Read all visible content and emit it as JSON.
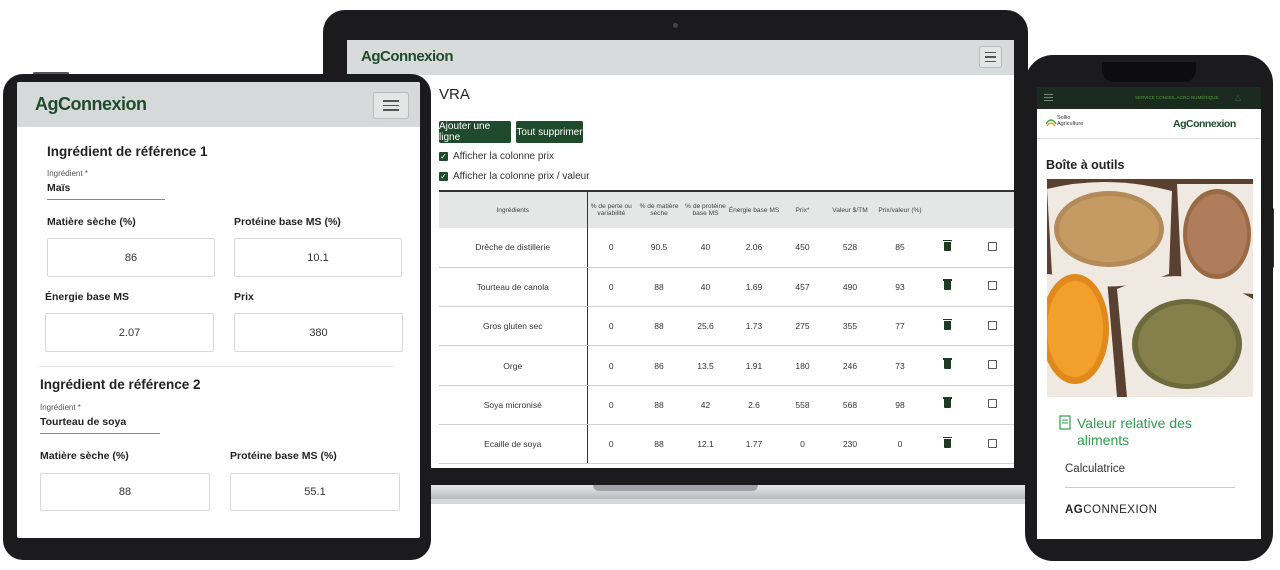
{
  "laptop": {
    "logo": "AgConnexion",
    "page_title": "VRA",
    "buttons": {
      "add_row": "Ajouter une ligne",
      "delete_all": "Tout supprimer"
    },
    "checkboxes": {
      "show_price": "Afficher la colonne prix",
      "show_price_value": "Afficher la colonne prix / valeur"
    },
    "table": {
      "headers": [
        "Ingrédients",
        "% de perte ou variabilité",
        "% de matière sèche",
        "% de protéine base MS",
        "Énergie base MS",
        "Prix*",
        "Valeur $/TM",
        "Prix/valeur (%)"
      ],
      "rows": [
        [
          "Drêche de distillerie",
          "0",
          "90.5",
          "40",
          "2.06",
          "450",
          "528",
          "85"
        ],
        [
          "Tourteau de canola",
          "0",
          "88",
          "40",
          "1.69",
          "457",
          "490",
          "93"
        ],
        [
          "Gros gluten sec",
          "0",
          "88",
          "25.6",
          "1.73",
          "275",
          "355",
          "77"
        ],
        [
          "Orge",
          "0",
          "86",
          "13.5",
          "1.91",
          "180",
          "246",
          "73"
        ],
        [
          "Soya micronisé",
          "0",
          "88",
          "42",
          "2.6",
          "558",
          "568",
          "98"
        ],
        [
          "Ecaille de soya",
          "0",
          "88",
          "12.1",
          "1.77",
          "0",
          "230",
          "0"
        ]
      ]
    }
  },
  "tablet": {
    "logo": "AgConnexion",
    "ref1": {
      "title": "Ingrédient de référence 1",
      "ingredient_label": "Ingrédient *",
      "ingredient_value": "Maïs",
      "dry_matter_label": "Matière sèche (%)",
      "dry_matter_value": "86",
      "protein_label": "Protéine base MS (%)",
      "protein_value": "10.1",
      "energy_label": "Énergie base MS",
      "energy_value": "2.07",
      "price_label": "Prix",
      "price_value": "380"
    },
    "ref2": {
      "title": "Ingrédient de référence 2",
      "ingredient_label": "Ingrédient *",
      "ingredient_value": "Tourteau de soya",
      "dry_matter_label": "Matière sèche (%)",
      "dry_matter_value": "88",
      "protein_label": "Protéine base MS (%)",
      "protein_value": "55.1"
    }
  },
  "phone": {
    "top_text": "SERVICE CONSEIL AGRO NUMÉRIQUE",
    "partner_logo_line1": "Sollio",
    "partner_logo_line2": "Agriculture",
    "logo": "AgConnexion",
    "toolbox_title": "Boîte à outils",
    "tool_link": "Valeur relative des aliments",
    "calculator": "Calculatrice",
    "brand_bold": "AG",
    "brand_rest": "CONNEXION"
  },
  "colors": {
    "brand_green": "#1f4b2c",
    "accent_green": "#2e9d4e",
    "header_gray": "#d8dbdb"
  }
}
